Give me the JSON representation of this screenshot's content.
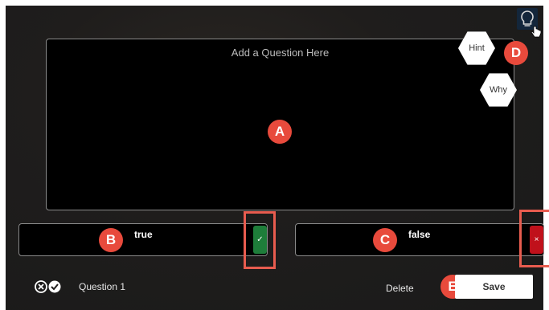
{
  "question": {
    "placeholder": "Add a Question Here"
  },
  "answers": [
    {
      "label": "true",
      "marker_icon": "check-icon",
      "marker_symbol": "✓",
      "marker_color": "#1e7d3a"
    },
    {
      "label": "false",
      "marker_icon": "close-icon",
      "marker_symbol": "×",
      "marker_color": "#c0111b"
    }
  ],
  "hints": {
    "hint_label": "Hint",
    "why_label": "Why",
    "toggle_icon": "lightbulb-icon"
  },
  "footer": {
    "status_icons": "incorrect-correct-icon",
    "question_label": "Question 1",
    "delete_label": "Delete",
    "save_label": "Save"
  },
  "callouts": {
    "a": "A",
    "b": "B",
    "c": "C",
    "d": "D",
    "e": "E"
  },
  "colors": {
    "callout": "#e84a3c",
    "highlight": "#e85c4f",
    "background": "#1f1d1c"
  }
}
